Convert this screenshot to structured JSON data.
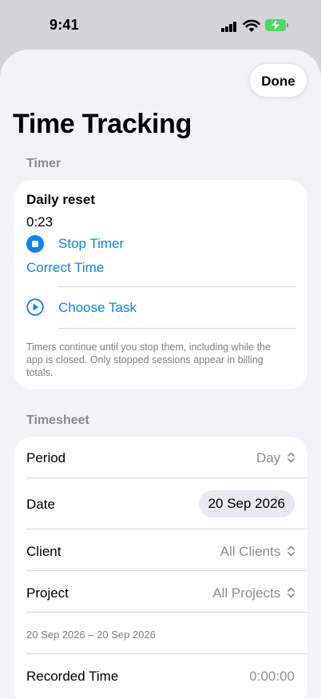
{
  "status_bar": {
    "time": "9:41"
  },
  "done_label": "Done",
  "title": "Time Tracking",
  "timer_section": {
    "header": "Timer",
    "task_name": "Daily reset",
    "elapsed": "0:23",
    "stop_label": "Stop Timer",
    "correct_label": "Correct Time",
    "choose_label": "Choose Task",
    "footnote": "Timers continue until you stop them, including while the app is closed. Only stopped sessions appear in billing totals."
  },
  "timesheet_section": {
    "header": "Timesheet",
    "period": {
      "label": "Period",
      "value": "Day"
    },
    "date": {
      "label": "Date",
      "value": "20 Sep 2026"
    },
    "client": {
      "label": "Client",
      "value": "All Clients"
    },
    "project": {
      "label": "Project",
      "value": "All Projects"
    },
    "range": "20 Sep 2026 – 20 Sep 2026",
    "recorded": {
      "label": "Recorded Time",
      "value": "0:00:00"
    }
  },
  "colors": {
    "accent": "#0a84ff",
    "battery": "#4cd964",
    "background": "#f2f2f7"
  }
}
